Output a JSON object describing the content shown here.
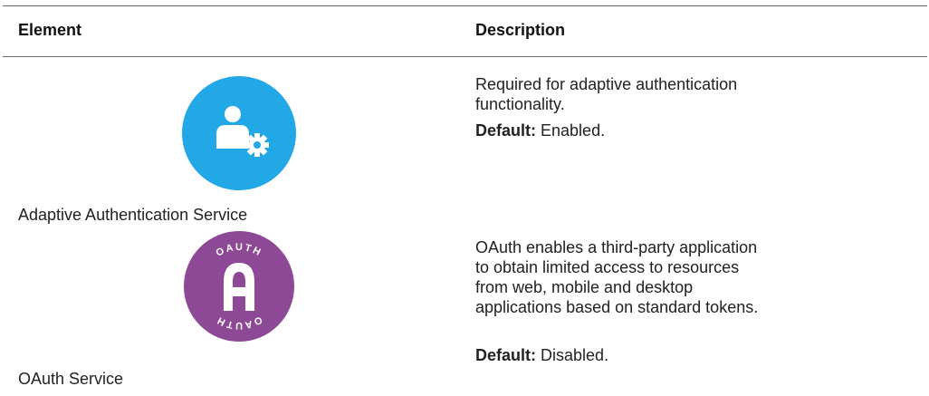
{
  "table": {
    "headers": {
      "element": "Element",
      "description": "Description"
    },
    "rows": [
      {
        "name": "Adaptive Authentication Service",
        "icon": "adaptive-authentication-icon",
        "icon_color": "#22a8e6",
        "description": "Required for adaptive authentication functionality.",
        "default_label": "Default:",
        "default_value": "Enabled."
      },
      {
        "name": "OAuth Service",
        "icon": "oauth-icon",
        "icon_color": "#8e4996",
        "icon_ring_text": "OAUTH",
        "description": "OAuth enables a third-party application to obtain limited access to resources from web, mobile and desktop applications based on standard tokens.",
        "default_label": "Default:",
        "default_value": "Disabled."
      }
    ]
  }
}
